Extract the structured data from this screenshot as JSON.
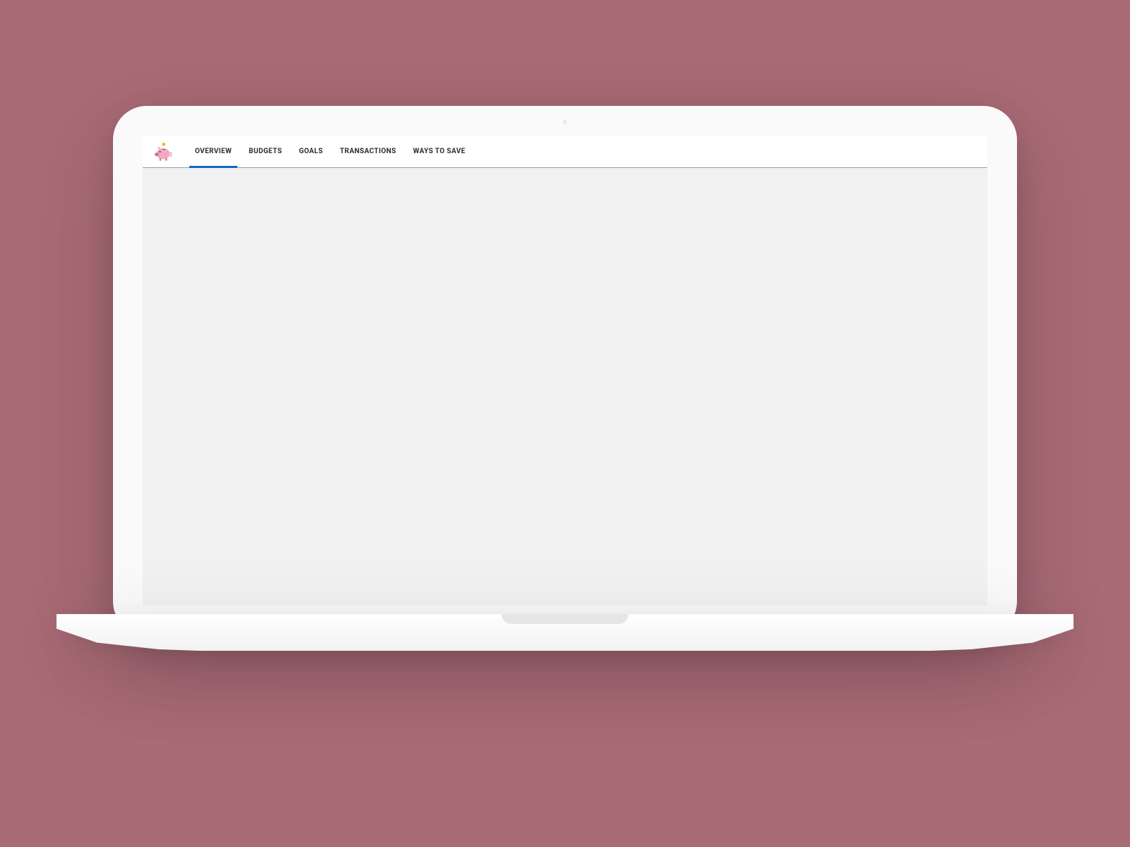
{
  "nav": {
    "logo_name": "piggy-bank-icon",
    "tabs": [
      {
        "label": "OVERVIEW",
        "active": true
      },
      {
        "label": "BUDGETS",
        "active": false
      },
      {
        "label": "GOALS",
        "active": false
      },
      {
        "label": "TRANSACTIONS",
        "active": false
      },
      {
        "label": "WAYS TO SAVE",
        "active": false
      }
    ]
  },
  "colors": {
    "background": "#a96b76",
    "accent": "#1565c0",
    "pig_body": "#f3a9bd",
    "pig_dark": "#d97a9a",
    "coin": "#f5c542"
  }
}
